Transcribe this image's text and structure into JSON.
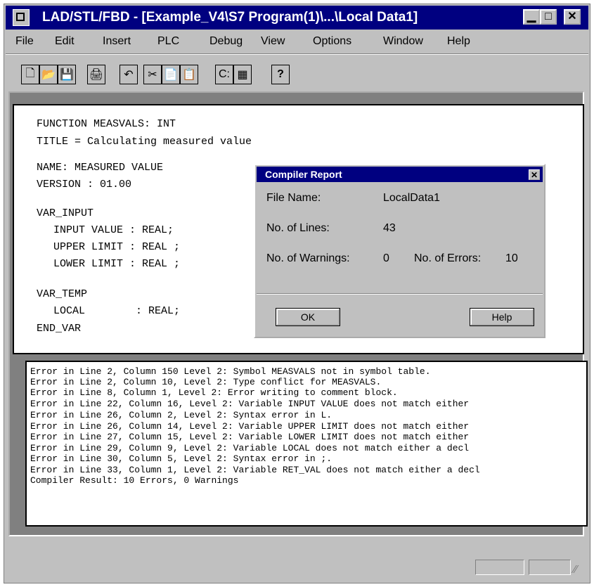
{
  "window": {
    "title": "LAD/STL/FBD - [Example_V4\\S7 Program(1)\\...\\Local Data1]",
    "controls": {
      "minimize": "▁",
      "maximize": "□",
      "close": "✕"
    }
  },
  "menu": [
    "File",
    "Edit",
    "Insert",
    "PLC",
    "Debug",
    "View",
    "Options",
    "Window",
    "Help"
  ],
  "toolbar": {
    "icons": [
      "new-icon",
      "open-icon",
      "save-icon",
      "print-icon",
      "undo-icon",
      "cut-icon",
      "copy-icon",
      "paste-icon",
      "compile-icon",
      "download-icon",
      "help-icon"
    ],
    "glyphs": [
      "🗋",
      "📂",
      "💾",
      "🖨",
      "↶",
      "✂",
      "📄",
      "📋",
      "C:",
      "▦",
      "?"
    ]
  },
  "editor": {
    "lines": [
      "FUNCTION MEASVALS: INT",
      "TITLE = Calculating measured value",
      "NAME: MEASURED VALUE",
      "VERSION : 01.00",
      "VAR_INPUT",
      "  INPUT VALUE : REAL;",
      "  UPPER LIMIT : REAL ;",
      "  LOWER LIMIT : REAL ;",
      "VAR_TEMP",
      "  LOCAL        : REAL;",
      "END_VAR"
    ]
  },
  "output": {
    "lines": [
      "Error in Line 2, Column 150 Level 2: Symbol MEASVALS not in symbol table.",
      "Error in Line 2, Column 10, Level 2: Type conflict for MEASVALS.",
      "Error in Line 8, Column 1, Level 2: Error writing to comment block.",
      "Error in Line 22, Column 16, Level 2: Variable INPUT VALUE does not match either",
      "Error in Line 26, Column 2, Level 2: Syntax error in L.",
      "Error in Line 26, Column 14, Level 2: Variable UPPER LIMIT does not match either",
      "Error in Line 27, Column 15, Level 2: Variable LOWER LIMIT does not match either",
      "Error in Line 29, Column 9, Level 2: Variable LOCAL does not match either a decl",
      "Error in Line 30, Column 5, Level 2: Syntax error in ;.",
      "Error in Line 33, Column 1, Level 2: Variable RET_VAL does not match either a decl",
      "Compiler Result: 10 Errors, 0 Warnings"
    ]
  },
  "dialog": {
    "title": "Compiler Report",
    "close": "✕",
    "file_name_label": "File Name:",
    "file_name_value": "LocalData1",
    "lines_label": "No. of Lines:",
    "lines_value": "43",
    "warnings_label": "No. of Warnings:",
    "warnings_value": "0",
    "errors_label": "No. of Errors:",
    "errors_value": "10",
    "ok_label": "OK",
    "help_label": "Help"
  }
}
